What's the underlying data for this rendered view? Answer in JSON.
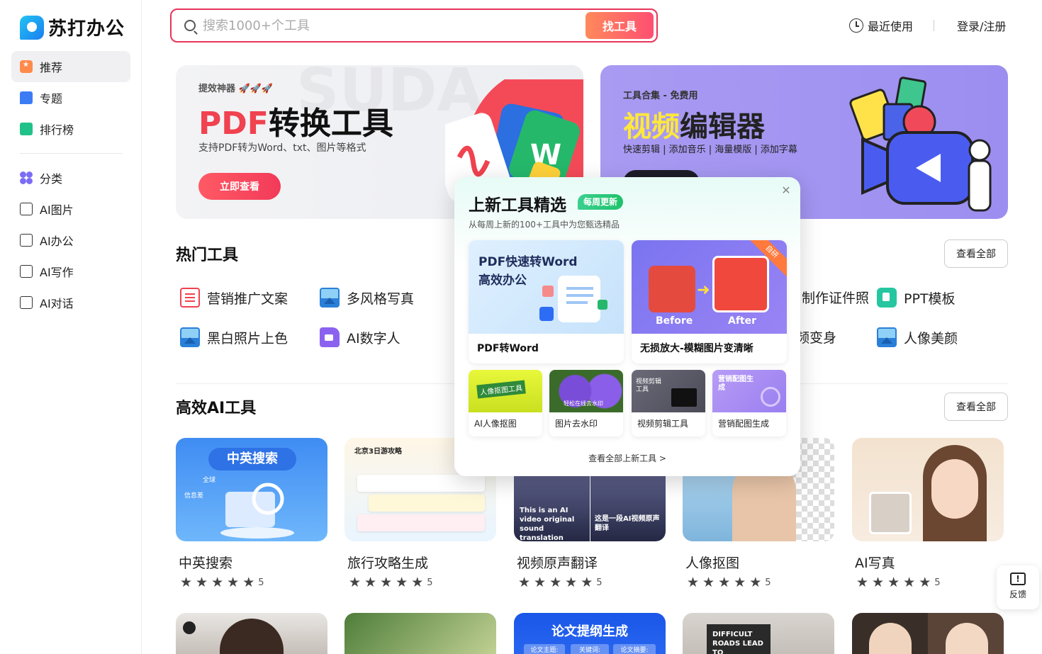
{
  "app": {
    "name": "苏打办公"
  },
  "sidebar": {
    "items": [
      {
        "label": "推荐"
      },
      {
        "label": "专题"
      },
      {
        "label": "排行榜"
      },
      {
        "label": "分类"
      },
      {
        "label": "AI图片"
      },
      {
        "label": "AI办公"
      },
      {
        "label": "AI写作"
      },
      {
        "label": "AI对话"
      }
    ]
  },
  "header": {
    "search_placeholder": "搜索1000+个工具",
    "search_button": "找工具",
    "recent": "最近使用",
    "login": "登录/注册"
  },
  "banners": {
    "left": {
      "tag": "提效神器 🚀🚀🚀",
      "title_accent": "PDF",
      "title_rest": "转换工具",
      "subtitle": "支持PDF转为Word、txt、图片等格式",
      "button": "立即查看"
    },
    "right": {
      "tag": "工具合集 - 免费用",
      "title_accent": "视频",
      "title_rest": "编辑器",
      "subtitle": "快速剪辑 | 添加音乐 | 海量模版 | 添加字幕"
    }
  },
  "hot": {
    "title": "热门工具",
    "see_all": "查看全部",
    "items": [
      {
        "label": "营销推广文案"
      },
      {
        "label": "多风格写真"
      },
      {
        "label": "制作证件照"
      },
      {
        "label": "PPT模板"
      },
      {
        "label": "黑白照片上色"
      },
      {
        "label": "AI数字人"
      },
      {
        "label": "视频变身"
      },
      {
        "label": "人像美颜"
      }
    ]
  },
  "ai": {
    "title": "高效AI工具",
    "see_all": "查看全部",
    "cards": [
      {
        "title": "中英搜索",
        "rating": "5",
        "thumb_text": "中英搜索",
        "thumb_sub1": "全球",
        "thumb_sub2": "信息差"
      },
      {
        "title": "旅行攻略生成",
        "rating": "5",
        "thumb_text": "北京3日游攻略"
      },
      {
        "title": "视频原声翻译",
        "rating": "5",
        "thumb_left": "This is an AI video original sound translation",
        "thumb_right": "这是一段AI视频原声翻译"
      },
      {
        "title": "人像抠图",
        "rating": "5"
      },
      {
        "title": "AI写真",
        "rating": "5"
      }
    ],
    "bottom_thumb_text": "论文提纲生成",
    "bottom_thumb_tags": [
      "论文主题:",
      "关键词:",
      "论文摘要:"
    ],
    "bottom_sign": "DIFFICULT ROADS LEAD TO"
  },
  "popup": {
    "title": "上新工具精选",
    "badge": "每周更新",
    "subtitle": "从每周上新的100+工具中为您甄选精品",
    "big_cards": [
      {
        "label": "PDF转Word",
        "thumb_text": "PDF快速转Word",
        "thumb_text2": "高效办公"
      },
      {
        "label": "无损放大-模糊图片变清晰",
        "before": "Before",
        "after": "After",
        "corner": "自研"
      }
    ],
    "small_cards": [
      {
        "label": "AI人像抠图",
        "thumb_text": "人像抠图工具"
      },
      {
        "label": "图片去水印",
        "thumb_text": "轻松在线去水印"
      },
      {
        "label": "视频剪辑工具",
        "thumb_text": "视频剪辑工具"
      },
      {
        "label": "营销配图生成",
        "thumb_text": "营销配图生成"
      }
    ],
    "more": "查看全部上新工具 >"
  },
  "feedback": {
    "label": "反馈"
  }
}
